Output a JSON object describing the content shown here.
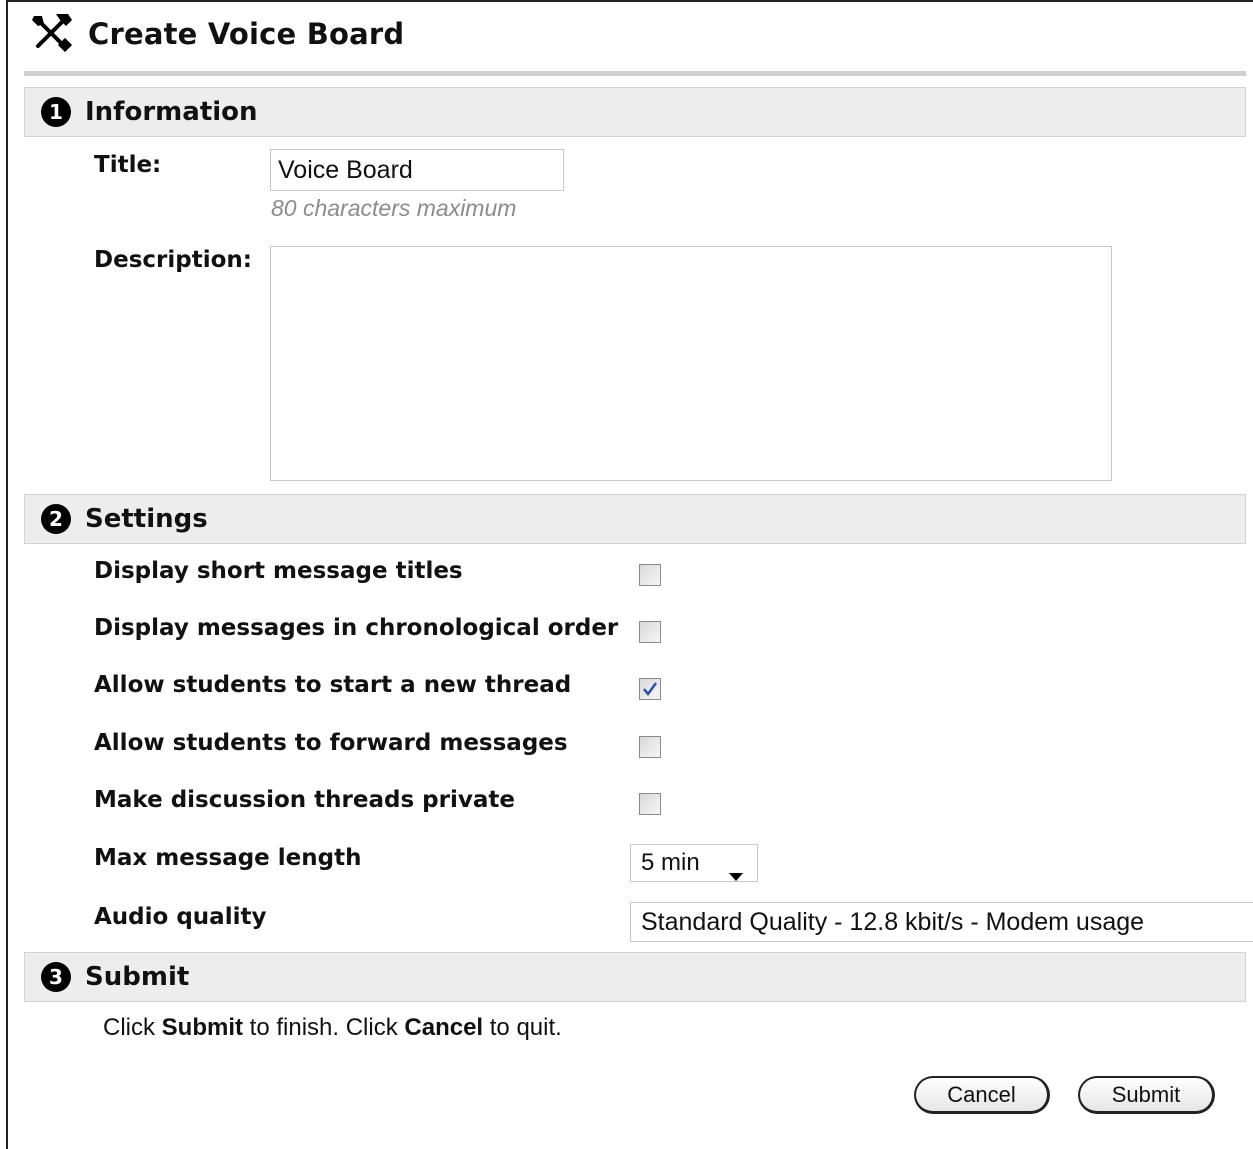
{
  "header": {
    "title": "Create Voice Board",
    "icon": "tools-icon"
  },
  "sections": {
    "information": {
      "number": "1",
      "title": "Information"
    },
    "settings": {
      "number": "2",
      "title": "Settings"
    },
    "submit": {
      "number": "3",
      "title": "Submit"
    }
  },
  "information": {
    "title_label": "Title:",
    "title_value": "Voice Board",
    "title_hint": "80 characters maximum",
    "description_label": "Description:",
    "description_value": ""
  },
  "settings": {
    "items": [
      {
        "label": "Display short message titles",
        "checked": false
      },
      {
        "label": "Display messages in chronological order",
        "checked": false
      },
      {
        "label": "Allow students to start a new thread",
        "checked": true
      },
      {
        "label": "Allow students to forward messages",
        "checked": false
      },
      {
        "label": "Make discussion threads private",
        "checked": false
      }
    ],
    "max_length_label": "Max message length",
    "max_length_value": "5 min",
    "audio_quality_label": "Audio quality",
    "audio_quality_value": "Standard Quality - 12.8 kbit/s - Modem usage"
  },
  "submit": {
    "instr_1": "Click ",
    "instr_submit": "Submit",
    "instr_2": " to finish. Click ",
    "instr_cancel": "Cancel",
    "instr_3": " to quit.",
    "cancel_label": "Cancel",
    "submit_label": "Submit"
  },
  "colors": {
    "section_bg": "#ededed",
    "checkmark": "#2b4fa8",
    "hint": "#8c8c8c"
  }
}
